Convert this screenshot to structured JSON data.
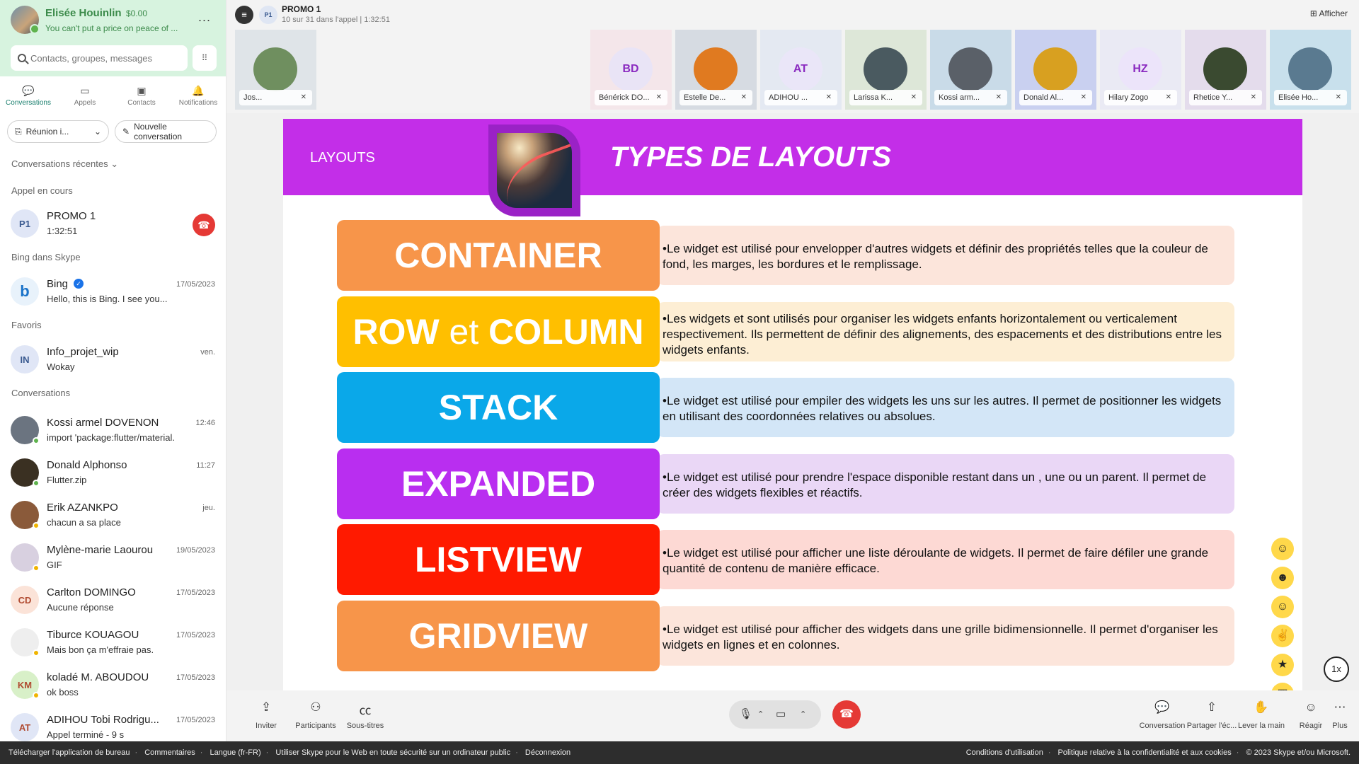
{
  "profile": {
    "name": "Elisée Houinlin",
    "credit": "$0.00",
    "mood": "You can't put a price on peace of ...",
    "more": "..."
  },
  "search": {
    "placeholder": "Contacts, groupes, messages"
  },
  "nav": [
    {
      "label": "Conversations",
      "icon": "chat-icon"
    },
    {
      "label": "Appels",
      "icon": "video-icon"
    },
    {
      "label": "Contacts",
      "icon": "contacts-icon"
    },
    {
      "label": "Notifications",
      "icon": "bell-icon"
    }
  ],
  "buttons": {
    "meeting": "Réunion i...",
    "new_conversation": "Nouvelle conversation"
  },
  "sections": {
    "recent": "Conversations récentes",
    "active_call": "Appel en cours",
    "bing": "Bing dans Skype",
    "favorites": "Favoris",
    "conversations": "Conversations"
  },
  "active_call": {
    "initials": "P1",
    "title": "PROMO 1",
    "duration": "1:32:51"
  },
  "bing": {
    "initials": "b",
    "title": "Bing",
    "sub": "Hello, this is Bing. I see you...",
    "time": "17/05/2023"
  },
  "favorite": {
    "initials": "IN",
    "title": "Info_projet_wip",
    "sub": "Wokay",
    "time": "ven."
  },
  "conversations": [
    {
      "initials": "",
      "title": "Kossi armel DOVENON",
      "sub": "import 'package:flutter/material....",
      "time": "12:46",
      "color": "#6b7480",
      "status": "#5fb34d"
    },
    {
      "initials": "",
      "title": "Donald Alphonso",
      "sub": "Flutter.zip",
      "time": "11:27",
      "color": "#3a3022",
      "status": "#5fb34d"
    },
    {
      "initials": "",
      "title": "Erik AZANKPO",
      "sub": "chacun a sa place",
      "time": "jeu.",
      "color": "#8a5a3a",
      "status": "#f0b400"
    },
    {
      "initials": "",
      "title": "Mylène-marie Laourou",
      "sub": "GIF",
      "time": "19/05/2023",
      "color": "#d8d0e0",
      "status": "#f0b400"
    },
    {
      "initials": "CD",
      "title": "Carlton DOMINGO",
      "sub": "Aucune réponse",
      "time": "17/05/2023",
      "color": "#fbe3d8",
      "status": ""
    },
    {
      "initials": "",
      "title": "Tiburce KOUAGOU",
      "sub": "Mais bon ça m'effraie pas.",
      "time": "17/05/2023",
      "color": "#eeeeee",
      "status": "#f0b400"
    },
    {
      "initials": "KM",
      "title": "koladé M. ABOUDOU",
      "sub": "ok boss",
      "time": "17/05/2023",
      "color": "#d8f0c8",
      "status": "#f0b400"
    },
    {
      "initials": "AT",
      "title": "ADIHOU Tobi Rodrigu...",
      "sub": "Appel terminé - 9 s",
      "time": "17/05/2023",
      "color": "#e0e6f6",
      "status": ""
    }
  ],
  "call": {
    "badge": "P1",
    "title": "PROMO 1",
    "subtitle": "10 sur 31 dans l'appel | 1:32:51",
    "view": "Afficher"
  },
  "participants": [
    {
      "name": "Jos...",
      "initials": "",
      "bg": "#dfe4e8",
      "avbg": "#6f8f5f"
    },
    {
      "name": "Bénérick DO...",
      "initials": "BD",
      "bg": "#f4e6ea",
      "avbg": "#e9e4f6"
    },
    {
      "name": "Estelle De...",
      "initials": "",
      "bg": "#d6dbe2",
      "avbg": "#e07a20"
    },
    {
      "name": "ADIHOU ...",
      "initials": "AT",
      "bg": "#e4e9f2",
      "avbg": "#eae6f8"
    },
    {
      "name": "Larissa K...",
      "initials": "",
      "bg": "#dde7d8",
      "avbg": "#4a5a60"
    },
    {
      "name": "Kossi arm...",
      "initials": "",
      "bg": "#c9dbe8",
      "avbg": "#5a6068"
    },
    {
      "name": "Donald Al...",
      "initials": "",
      "bg": "#c9d0f0",
      "avbg": "#d8a020"
    },
    {
      "name": "Hilary Zogo",
      "initials": "HZ",
      "bg": "#eaeaf4",
      "avbg": "#ece4fa"
    },
    {
      "name": "Rhetice Y...",
      "initials": "",
      "bg": "#e4dcec",
      "avbg": "#3a4a30"
    },
    {
      "name": "Elisée Ho...",
      "initials": "",
      "bg": "#c8e0ec",
      "avbg": "#5a7a90"
    }
  ],
  "slide": {
    "section_label": "LAYOUTS",
    "title": "TYPES DE LAYOUTS",
    "rows": [
      {
        "label": "CONTAINER",
        "color": "#f7954a",
        "desc_bg": "#fce5db",
        "desc": "•Le widget est utilisé pour envelopper d'autres widgets et définir des propriétés telles que la couleur de fond, les marges, les bordures et le remplissage."
      },
      {
        "label_a": "ROW ",
        "label_et": "et",
        "label_b": " COLUMN",
        "color": "#ffbf00",
        "desc_bg": "#fdeed4",
        "desc": "•Les widgets et sont utilisés pour organiser les widgets enfants horizontalement ou verticalement respectivement. Ils permettent de définir des alignements, des espacements et des distributions entre les widgets enfants."
      },
      {
        "label": "STACK",
        "color": "#0aa8e9",
        "desc_bg": "#d3e6f7",
        "desc": "•Le widget est utilisé pour empiler des widgets les uns sur les autres. Il permet de positionner les widgets en utilisant des coordonnées relatives ou absolues."
      },
      {
        "label": "EXPANDED",
        "color": "#b92ef0",
        "desc_bg": "#ead7f6",
        "desc": "•Le widget est utilisé pour prendre l'espace disponible restant dans un , une ou un parent. Il permet de créer des widgets flexibles et réactifs."
      },
      {
        "label": "LISTVIEW",
        "color": "#ff1a00",
        "desc_bg": "#fdd9d4",
        "desc": "•Le widget est utilisé pour afficher une liste déroulante de widgets. Il permet de faire défiler une grande quantité de contenu de manière efficace."
      },
      {
        "label": "GRIDVIEW",
        "color": "#f7954a",
        "desc_bg": "#fce5db",
        "desc": "•Le widget est utilisé pour afficher des widgets dans une grille bidimensionnelle. Il permet d'organiser les widgets en lignes et en colonnes."
      }
    ]
  },
  "speed": "1x",
  "controls": {
    "invite": "Inviter",
    "participants": "Participants",
    "captions": "Sous-titres",
    "conversation": "Conversation",
    "share": "Partager l'éc...",
    "raise_hand": "Lever la main",
    "react": "Réagir",
    "more": "Plus"
  },
  "footer": {
    "links": [
      "Télécharger l'application de bureau",
      "Commentaires",
      "Langue (fr-FR)",
      "Utiliser Skype pour le Web en toute sécurité sur un ordinateur public",
      "Déconnexion"
    ],
    "right": [
      "Conditions d'utilisation",
      "Politique relative à la confidentialité et aux cookies",
      "© 2023 Skype et/ou Microsoft."
    ]
  }
}
